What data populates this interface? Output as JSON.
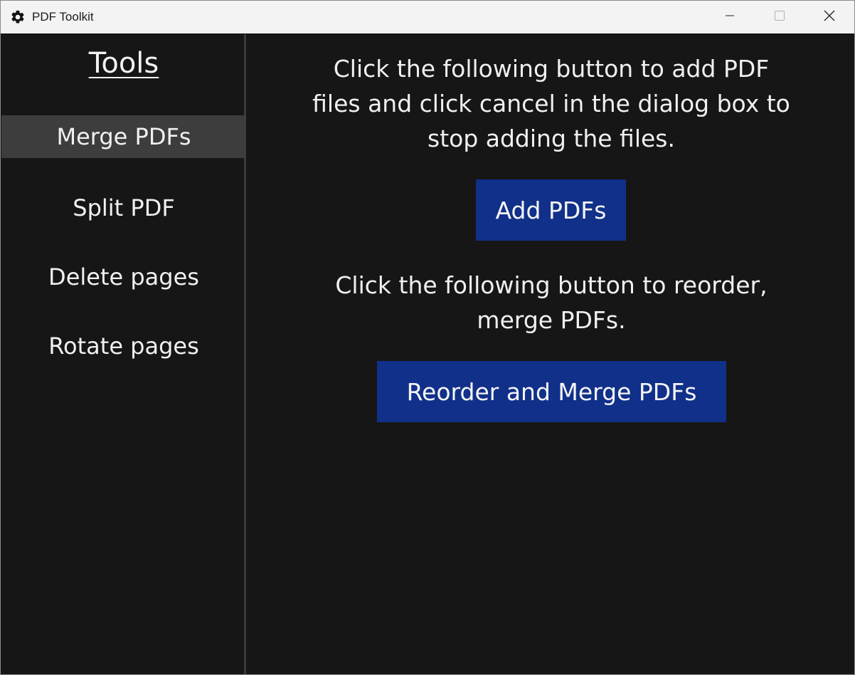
{
  "window": {
    "title": "PDF Toolkit",
    "icon": "gear-icon"
  },
  "window_controls": {
    "minimize": "minimize-icon",
    "maximize": "maximize-icon",
    "close": "close-icon"
  },
  "sidebar": {
    "title": "Tools",
    "items": [
      {
        "label": "Merge PDFs",
        "active": true
      },
      {
        "label": "Split PDF",
        "active": false
      },
      {
        "label": "Delete pages",
        "active": false
      },
      {
        "label": "Rotate pages",
        "active": false
      }
    ]
  },
  "main": {
    "add_instructions_line1": "Click the following button to add PDF",
    "add_instructions_line2": "files and click cancel in the dialog box to",
    "add_instructions_line3": "stop adding the files.",
    "add_button_label": "Add PDFs",
    "reorder_instructions_line1": "Click the following button to reorder,",
    "reorder_instructions_line2": "merge PDFs.",
    "reorder_button_label": "Reorder and Merge PDFs"
  },
  "colors": {
    "background": "#161616",
    "sidebar_active": "#3d3d3d",
    "button": "#11308a",
    "text": "#f0f0f0"
  }
}
